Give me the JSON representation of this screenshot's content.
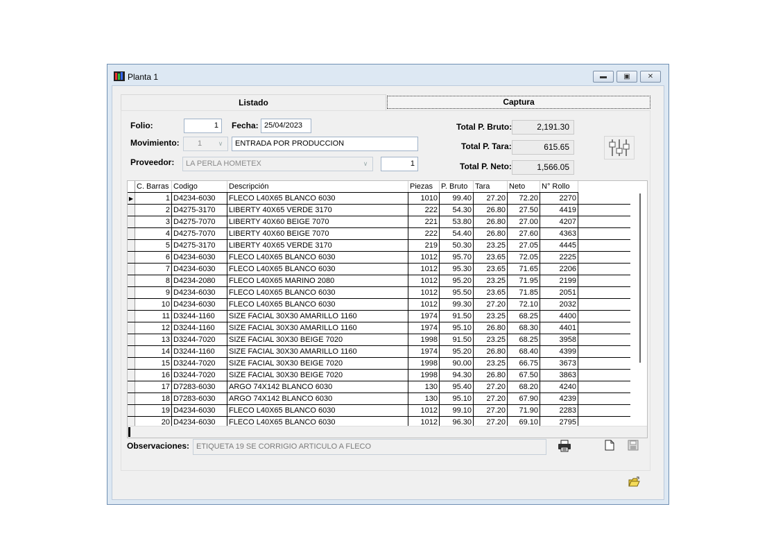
{
  "window": {
    "title": "Planta 1"
  },
  "tabs": {
    "listado": "Listado",
    "captura": "Captura"
  },
  "form": {
    "folio_label": "Folio:",
    "folio_value": "1",
    "fecha_label": "Fecha:",
    "fecha_value": "25/04/2023",
    "movimiento_label": "Movimiento:",
    "movimiento_value": "1",
    "movimiento_desc": "ENTRADA POR PRODUCCION",
    "proveedor_label": "Proveedor:",
    "proveedor_value": "LA PERLA HOMETEX",
    "proveedor_num": "1"
  },
  "totals": {
    "bruto_label": "Total P. Bruto:",
    "bruto_value": "2,191.30",
    "tara_label": "Total P. Tara:",
    "tara_value": "615.65",
    "neto_label": "Total P. Neto:",
    "neto_value": "1,566.05"
  },
  "grid": {
    "columns": [
      "C. Barras",
      "Codigo",
      "Descripción",
      "Piezas",
      "P. Bruto",
      "Tara",
      "Neto",
      "N° Rollo"
    ],
    "rows": [
      [
        "1",
        "D4234-6030",
        "FLECO L40X65 BLANCO 6030",
        "1010",
        "99.40",
        "27.20",
        "72.20",
        "2270"
      ],
      [
        "2",
        "D4275-3170",
        "LIBERTY 40X65 VERDE 3170",
        "222",
        "54.30",
        "26.80",
        "27.50",
        "4419"
      ],
      [
        "3",
        "D4275-7070",
        "LIBERTY 40X60 BEIGE 7070",
        "221",
        "53.80",
        "26.80",
        "27.00",
        "4207"
      ],
      [
        "4",
        "D4275-7070",
        "LIBERTY 40X60 BEIGE 7070",
        "222",
        "54.40",
        "26.80",
        "27.60",
        "4363"
      ],
      [
        "5",
        "D4275-3170",
        "LIBERTY 40X65 VERDE 3170",
        "219",
        "50.30",
        "23.25",
        "27.05",
        "4445"
      ],
      [
        "6",
        "D4234-6030",
        "FLECO L40X65 BLANCO 6030",
        "1012",
        "95.70",
        "23.65",
        "72.05",
        "2225"
      ],
      [
        "7",
        "D4234-6030",
        "FLECO L40X65 BLANCO 6030",
        "1012",
        "95.30",
        "23.65",
        "71.65",
        "2206"
      ],
      [
        "8",
        "D4234-2080",
        "FLECO L40X65 MARINO 2080",
        "1012",
        "95.20",
        "23.25",
        "71.95",
        "2199"
      ],
      [
        "9",
        "D4234-6030",
        "FLECO L40X65 BLANCO 6030",
        "1012",
        "95.50",
        "23.65",
        "71.85",
        "2051"
      ],
      [
        "10",
        "D4234-6030",
        "FLECO L40X65 BLANCO 6030",
        "1012",
        "99.30",
        "27.20",
        "72.10",
        "2032"
      ],
      [
        "11",
        "D3244-1160",
        "SIZE FACIAL 30X30 AMARILLO 1160",
        "1974",
        "91.50",
        "23.25",
        "68.25",
        "4400"
      ],
      [
        "12",
        "D3244-1160",
        "SIZE FACIAL 30X30 AMARILLO 1160",
        "1974",
        "95.10",
        "26.80",
        "68.30",
        "4401"
      ],
      [
        "13",
        "D3244-7020",
        "SIZE FACIAL 30X30 BEIGE 7020",
        "1998",
        "91.50",
        "23.25",
        "68.25",
        "3958"
      ],
      [
        "14",
        "D3244-1160",
        "SIZE FACIAL 30X30 AMARILLO 1160",
        "1974",
        "95.20",
        "26.80",
        "68.40",
        "4399"
      ],
      [
        "15",
        "D3244-7020",
        "SIZE FACIAL 30X30 BEIGE 7020",
        "1998",
        "90.00",
        "23.25",
        "66.75",
        "3673"
      ],
      [
        "16",
        "D3244-7020",
        "SIZE FACIAL 30X30 BEIGE 7020",
        "1998",
        "94.30",
        "26.80",
        "67.50",
        "3863"
      ],
      [
        "17",
        "D7283-6030",
        "ARGO 74X142 BLANCO 6030",
        "130",
        "95.40",
        "27.20",
        "68.20",
        "4240"
      ],
      [
        "18",
        "D7283-6030",
        "ARGO 74X142 BLANCO 6030",
        "130",
        "95.10",
        "27.20",
        "67.90",
        "4239"
      ],
      [
        "19",
        "D4234-6030",
        "FLECO L40X65 BLANCO 6030",
        "1012",
        "99.10",
        "27.20",
        "71.90",
        "2283"
      ],
      [
        "20",
        "D4234-6030",
        "FLECO L40X65 BLANCO 6030",
        "1012",
        "96.30",
        "27.20",
        "69.10",
        "2795"
      ]
    ]
  },
  "observaciones": {
    "label": "Observaciones:",
    "value": "ETIQUETA 19 SE CORRIGIO ARTICULO A FLECO"
  },
  "icons": {
    "settings": "sliders-icon",
    "print": "printer-icon",
    "new": "new-document-icon",
    "save": "save-icon",
    "exit": "open-folder-icon"
  }
}
